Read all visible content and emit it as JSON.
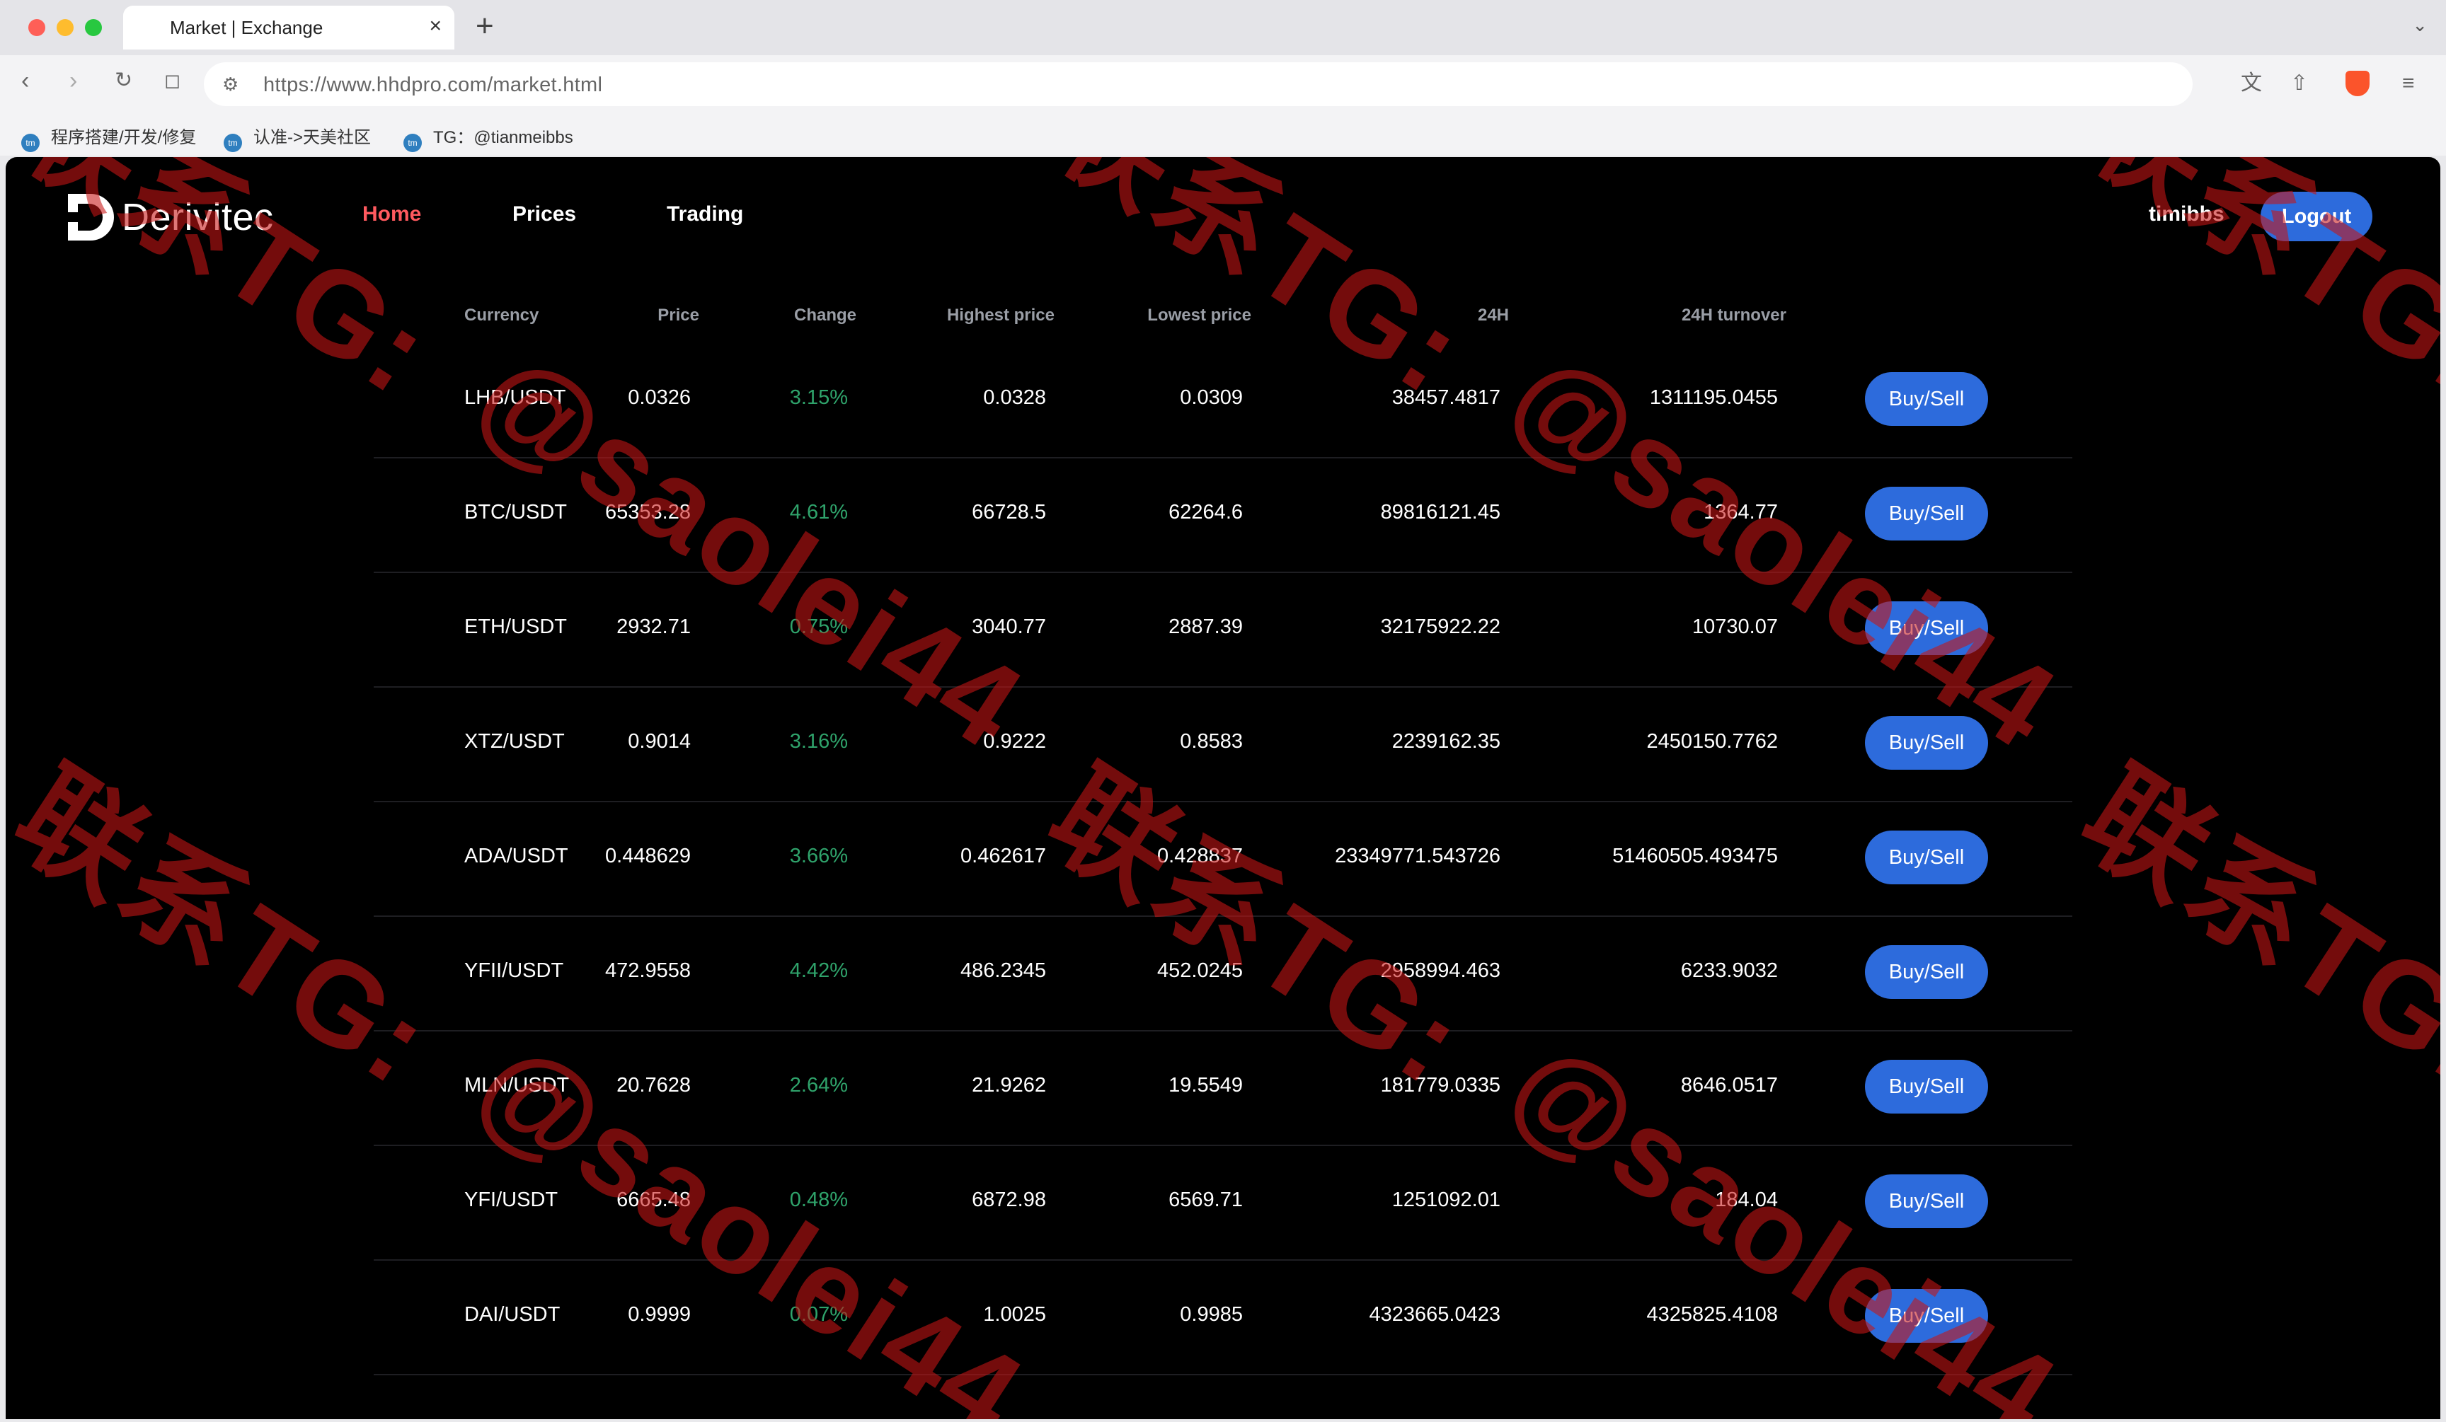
{
  "browser": {
    "tab_title": "Market | Exchange",
    "tab_close": "×",
    "new_tab": "+",
    "url": "https://www.hhdpro.com/market.html",
    "bookmarks": [
      "程序搭建/开发/修复",
      "认准->天美社区",
      "TG：@tianmeibbs"
    ]
  },
  "site": {
    "logo_text": "Derivitec",
    "nav": [
      "Home",
      "Prices",
      "Trading"
    ],
    "active_nav": "Home",
    "username": "timibbs",
    "logout_label": "Logout"
  },
  "market": {
    "columns": [
      "Currency",
      "Price",
      "Change",
      "Highest price",
      "Lowest price",
      "24H",
      "24H turnover"
    ],
    "button_label": "Buy/Sell",
    "rows": [
      {
        "pair": "LHB/USDT",
        "price": "0.0326",
        "change": "3.15%",
        "high": "0.0328",
        "low": "0.0309",
        "vol24h": "38457.4817",
        "turnover": "1311195.0455"
      },
      {
        "pair": "BTC/USDT",
        "price": "65353.28",
        "change": "4.61%",
        "high": "66728.5",
        "low": "62264.6",
        "vol24h": "89816121.45",
        "turnover": "1364.77"
      },
      {
        "pair": "ETH/USDT",
        "price": "2932.71",
        "change": "0.75%",
        "high": "3040.77",
        "low": "2887.39",
        "vol24h": "32175922.22",
        "turnover": "10730.07"
      },
      {
        "pair": "XTZ/USDT",
        "price": "0.9014",
        "change": "3.16%",
        "high": "0.9222",
        "low": "0.8583",
        "vol24h": "2239162.35",
        "turnover": "2450150.7762"
      },
      {
        "pair": "ADA/USDT",
        "price": "0.448629",
        "change": "3.66%",
        "high": "0.462617",
        "low": "0.428837",
        "vol24h": "23349771.543726",
        "turnover": "51460505.493475"
      },
      {
        "pair": "YFII/USDT",
        "price": "472.9558",
        "change": "4.42%",
        "high": "486.2345",
        "low": "452.0245",
        "vol24h": "2958994.463",
        "turnover": "6233.9032"
      },
      {
        "pair": "MLN/USDT",
        "price": "20.7628",
        "change": "2.64%",
        "high": "21.9262",
        "low": "19.5549",
        "vol24h": "181779.0335",
        "turnover": "8646.0517"
      },
      {
        "pair": "YFI/USDT",
        "price": "6665.48",
        "change": "0.48%",
        "high": "6872.98",
        "low": "6569.71",
        "vol24h": "1251092.01",
        "turnover": "184.04"
      },
      {
        "pair": "DAI/USDT",
        "price": "0.9999",
        "change": "0.07%",
        "high": "1.0025",
        "low": "0.9985",
        "vol24h": "4323665.0423",
        "turnover": "4325825.4108"
      }
    ]
  },
  "watermark": {
    "line_a": "联系TG:",
    "line_b": "@saolei44",
    "color": "#c81414"
  },
  "colors": {
    "accent_blue": "#2d6bdc",
    "change_green": "#2fa36b",
    "active_nav_red": "#ff5a5f",
    "background": "#000000"
  }
}
